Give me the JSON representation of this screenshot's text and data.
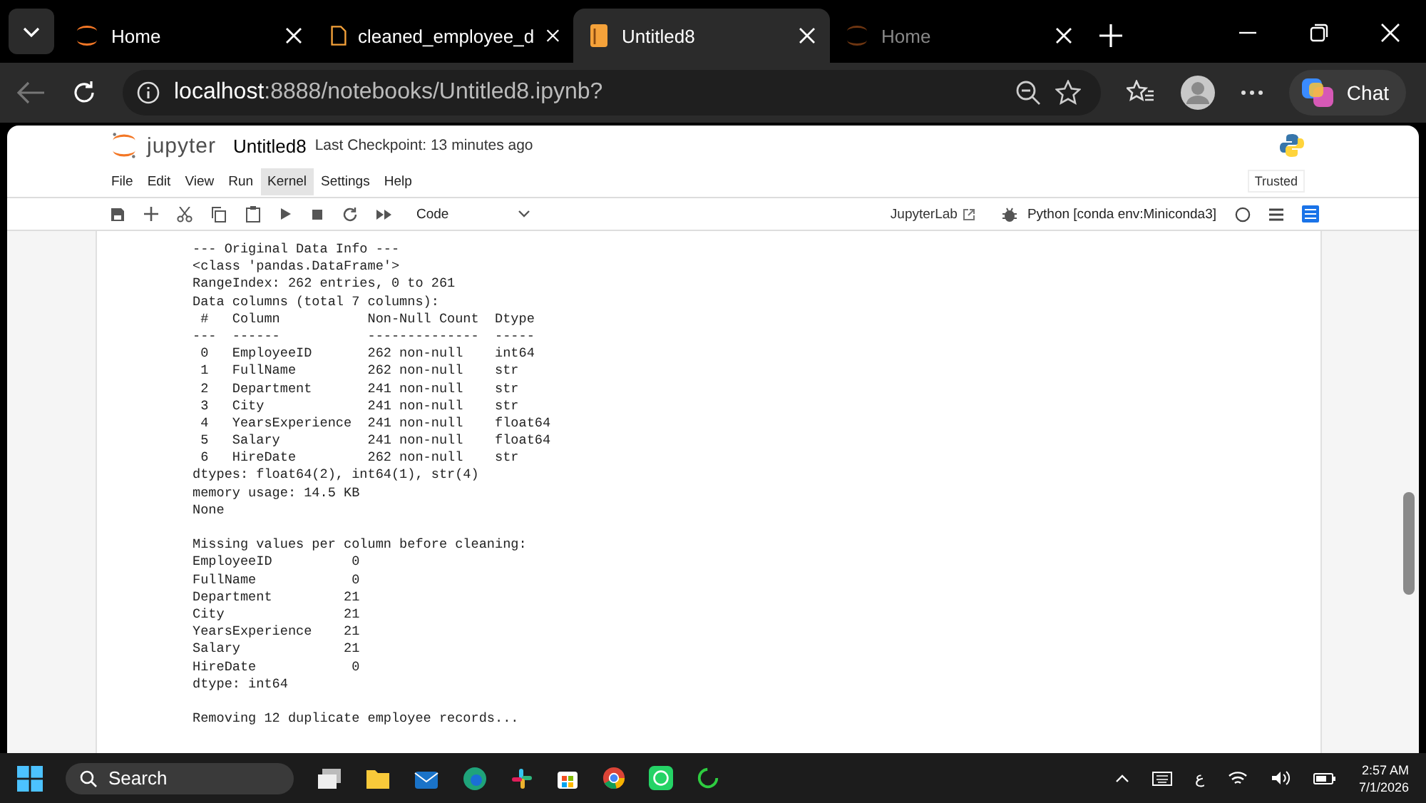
{
  "browser_tabs": [
    {
      "title": "Home",
      "selected": false,
      "kind": "jupyter"
    },
    {
      "title": "cleaned_employee_d",
      "selected": false,
      "kind": "file"
    },
    {
      "title": "Untitled8",
      "selected": true,
      "kind": "notebook"
    },
    {
      "title": "Home",
      "selected": false,
      "kind": "jupyter-dim"
    }
  ],
  "address_bar": {
    "host": "localhost",
    "path": ":8888/notebooks/Untitled8.ipynb?"
  },
  "chat_button": "Chat",
  "jupyter": {
    "logo_text": "jupyter",
    "notebook_name": "Untitled8",
    "checkpoint": "Last Checkpoint: 13 minutes ago",
    "menu": [
      {
        "label": "File",
        "selected": false
      },
      {
        "label": "Edit",
        "selected": false
      },
      {
        "label": "View",
        "selected": false
      },
      {
        "label": "Run",
        "selected": false
      },
      {
        "label": "Kernel",
        "selected": true
      },
      {
        "label": "Settings",
        "selected": false
      },
      {
        "label": "Help",
        "selected": false
      }
    ],
    "trusted": "Trusted",
    "cell_type": "Code",
    "jupyterlab_link": "JupyterLab",
    "kernel_name": "Python [conda env:Miniconda3]"
  },
  "output_blocks": [
    [
      "--- Original Data Info ---",
      "<class 'pandas.DataFrame'>",
      "RangeIndex: 262 entries, 0 to 261",
      "Data columns (total 7 columns):",
      " #   Column           Non-Null Count  Dtype  ",
      "---  ------           --------------  -----  ",
      " 0   EmployeeID       262 non-null    int64  ",
      " 1   FullName         262 non-null    str    ",
      " 2   Department       241 non-null    str    ",
      " 3   City             241 non-null    str    ",
      " 4   YearsExperience  241 non-null    float64",
      " 5   Salary           241 non-null    float64",
      " 6   HireDate         262 non-null    str    ",
      "dtypes: float64(2), int64(1), str(4)",
      "memory usage: 14.5 KB",
      "None"
    ],
    [
      "Missing values per column before cleaning:",
      "EmployeeID          0",
      "FullName            0",
      "Department         21",
      "City               21",
      "YearsExperience    21",
      "Salary             21",
      "HireDate            0",
      "dtype: int64"
    ],
    [
      "Removing 12 duplicate employee records..."
    ]
  ],
  "taskbar": {
    "search": "Search",
    "language": "ع",
    "time": "2:57 AM",
    "date": "7/1/2026"
  }
}
